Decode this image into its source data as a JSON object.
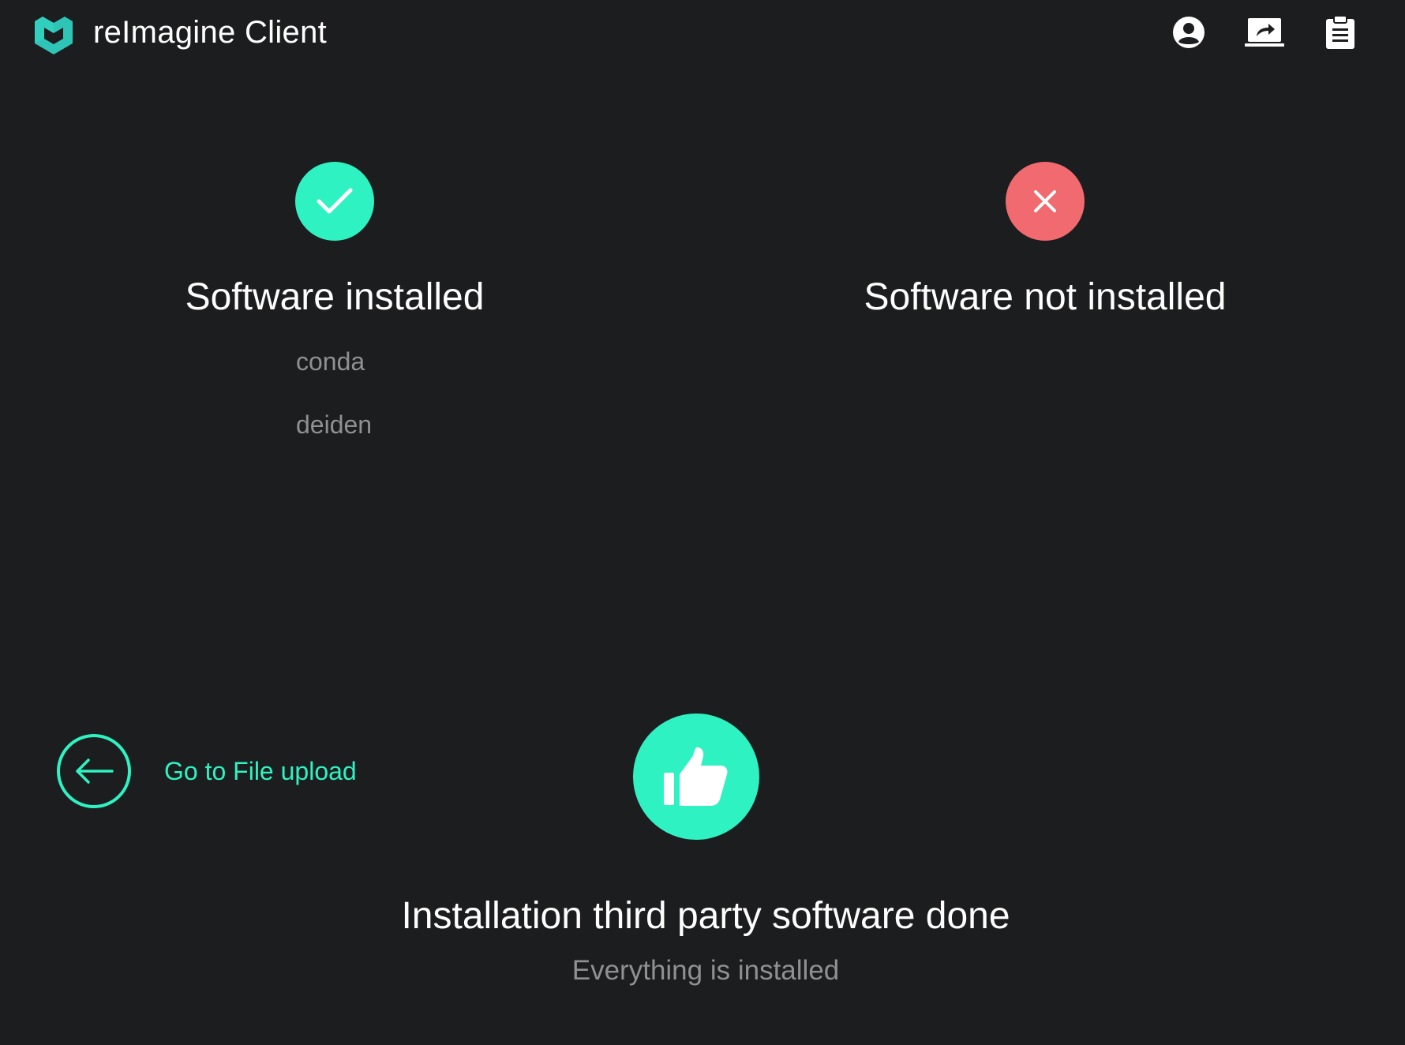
{
  "header": {
    "app_title": "reImagine Client",
    "icons": [
      "profile-icon",
      "share-screen-icon",
      "clipboard-icon"
    ]
  },
  "installed": {
    "title": "Software installed",
    "icon": "check-icon",
    "packages": [
      "conda",
      "deiden"
    ]
  },
  "not_installed": {
    "title": "Software not installed",
    "icon": "close-icon",
    "packages": []
  },
  "back_link": {
    "label": "Go to File upload",
    "icon": "arrow-left-icon"
  },
  "done": {
    "icon": "thumbs-up-icon",
    "title": "Installation third party software done",
    "subtitle": "Everything is installed"
  },
  "colors": {
    "background": "#1c1d1f",
    "accent": "#2ff2c2",
    "error": "#f06a6f",
    "muted_text": "#8f9092",
    "text": "#ffffff"
  }
}
